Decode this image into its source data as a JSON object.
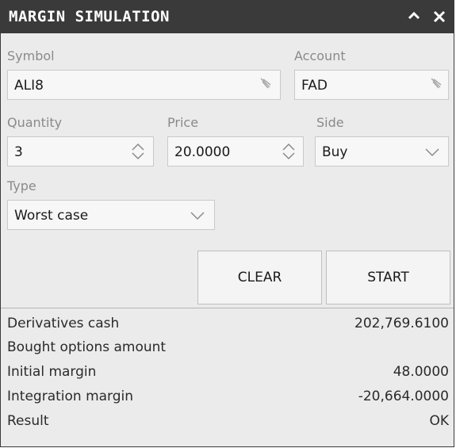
{
  "window": {
    "title": "MARGIN SIMULATION"
  },
  "titlebar": {
    "collapse_icon": "chevron-up-icon",
    "close_icon": "close-icon"
  },
  "form": {
    "symbol": {
      "label": "Symbol",
      "value": "ALI8",
      "icon": "edit-pen-icon"
    },
    "account": {
      "label": "Account",
      "value": "FAD",
      "icon": "edit-pen-icon"
    },
    "quantity": {
      "label": "Quantity",
      "value": "3",
      "icon": "spinner-icon"
    },
    "price": {
      "label": "Price",
      "value": "20.0000",
      "icon": "spinner-icon"
    },
    "side": {
      "label": "Side",
      "value": "Buy",
      "icon": "chevron-down-icon"
    },
    "type": {
      "label": "Type",
      "value": "Worst case",
      "icon": "chevron-down-icon"
    }
  },
  "buttons": {
    "clear": "CLEAR",
    "start": "START"
  },
  "results": [
    {
      "label": "Derivatives cash",
      "value": "202,769.6100"
    },
    {
      "label": "Bought options amount",
      "value": ""
    },
    {
      "label": "Initial margin",
      "value": "48.0000"
    },
    {
      "label": "Integration margin",
      "value": "-20,664.0000"
    },
    {
      "label": "Result",
      "value": "OK"
    }
  ],
  "colors": {
    "titlebar": "#3a3a3a",
    "panel": "#ebebeb",
    "field": "#f7f7f7"
  }
}
